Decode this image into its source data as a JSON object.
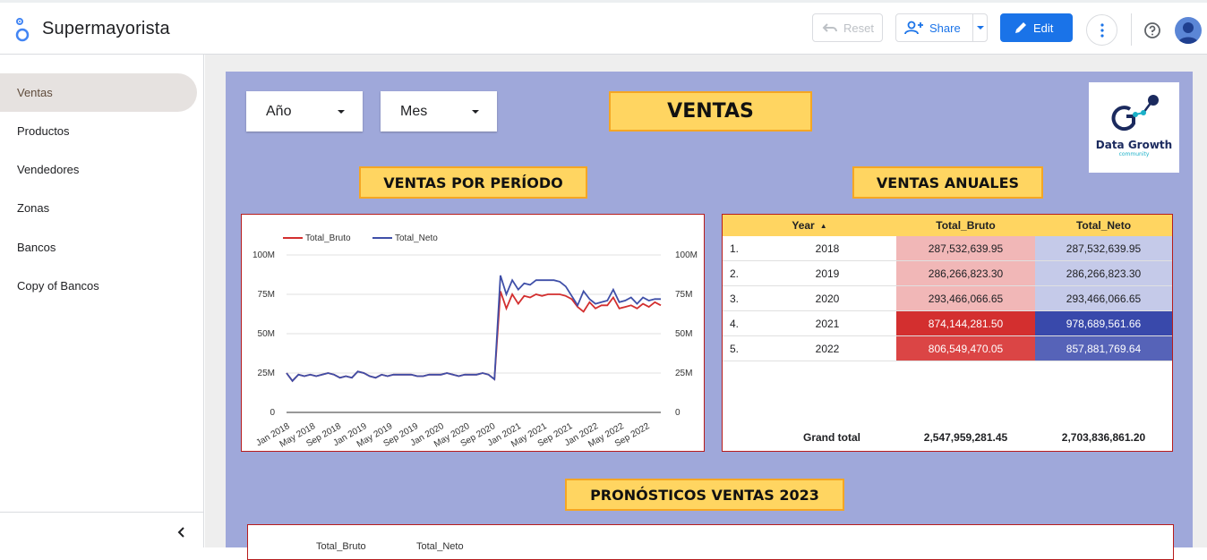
{
  "app": {
    "title": "Supermayorista"
  },
  "toolbar": {
    "reset_label": "Reset",
    "share_label": "Share",
    "edit_label": "Edit"
  },
  "sidebar": {
    "items": [
      {
        "label": "Ventas",
        "active": true
      },
      {
        "label": "Productos"
      },
      {
        "label": "Vendedores"
      },
      {
        "label": "Zonas"
      },
      {
        "label": "Bancos"
      },
      {
        "label": "Copy of Bancos"
      }
    ]
  },
  "filters": {
    "year_label": "Año",
    "month_label": "Mes"
  },
  "report": {
    "main_title": "VENTAS",
    "period_title": "VENTAS POR PERÍODO",
    "annual_title": "VENTAS ANUALES",
    "forecast_title": "PRONÓSTICOS VENTAS 2023",
    "logo_text": "Data Growth",
    "logo_subtext": "community"
  },
  "chart_data": {
    "type": "line",
    "legend": [
      "Total_Bruto",
      "Total_Neto"
    ],
    "colors": {
      "Total_Bruto": "#d32f2f",
      "Total_Neto": "#3f4fa8"
    },
    "y_ticks": [
      "100M",
      "75M",
      "50M",
      "25M",
      "0"
    ],
    "ylim": [
      0,
      100000000
    ],
    "x_tick_labels": [
      "Jan 2018",
      "May 2018",
      "Sep 2018",
      "Jan 2019",
      "May 2019",
      "Sep 2019",
      "Jan 2020",
      "May 2020",
      "Sep 2020",
      "Jan 2021",
      "May 2021",
      "Sep 2021",
      "Jan 2022",
      "May 2022",
      "Sep 2022"
    ],
    "x": [
      "Jan 2018",
      "Feb 2018",
      "Mar 2018",
      "Apr 2018",
      "May 2018",
      "Jun 2018",
      "Jul 2018",
      "Aug 2018",
      "Sep 2018",
      "Oct 2018",
      "Nov 2018",
      "Dec 2018",
      "Jan 2019",
      "Feb 2019",
      "Mar 2019",
      "Apr 2019",
      "May 2019",
      "Jun 2019",
      "Jul 2019",
      "Aug 2019",
      "Sep 2019",
      "Oct 2019",
      "Nov 2019",
      "Dec 2019",
      "Jan 2020",
      "Feb 2020",
      "Mar 2020",
      "Apr 2020",
      "May 2020",
      "Jun 2020",
      "Jul 2020",
      "Aug 2020",
      "Sep 2020",
      "Oct 2020",
      "Nov 2020",
      "Dec 2020",
      "Jan 2021",
      "Feb 2021",
      "Mar 2021",
      "Apr 2021",
      "May 2021",
      "Jun 2021",
      "Jul 2021",
      "Aug 2021",
      "Sep 2021",
      "Oct 2021",
      "Nov 2021",
      "Dec 2021",
      "Jan 2022",
      "Feb 2022",
      "Mar 2022",
      "Apr 2022",
      "May 2022",
      "Jun 2022",
      "Jul 2022",
      "Aug 2022",
      "Sep 2022",
      "Oct 2022",
      "Nov 2022",
      "Dec 2022"
    ],
    "series": [
      {
        "name": "Total_Bruto",
        "values": [
          25,
          20,
          24,
          23,
          24,
          23,
          24,
          25,
          24,
          22,
          23,
          22,
          26,
          25,
          23,
          22,
          24,
          23,
          24,
          24,
          24,
          24,
          23,
          23,
          24,
          24,
          24,
          25,
          24,
          23,
          24,
          24,
          24,
          25,
          24,
          21,
          77,
          66,
          75,
          69,
          74,
          73,
          75,
          74,
          75,
          75,
          75,
          74,
          72,
          67,
          64,
          70,
          66,
          68,
          68,
          73,
          66,
          67,
          68,
          66,
          69,
          67,
          70,
          68
        ],
        "note_series_length_matches_x": ""
      },
      {
        "name": "Total_Neto",
        "values": [
          25,
          20,
          24,
          23,
          24,
          23,
          24,
          25,
          24,
          22,
          23,
          22,
          26,
          25,
          23,
          22,
          24,
          23,
          24,
          24,
          24,
          24,
          23,
          23,
          24,
          24,
          24,
          25,
          24,
          23,
          24,
          24,
          24,
          25,
          24,
          21,
          87,
          75,
          84,
          78,
          82,
          81,
          84,
          84,
          84,
          84,
          83,
          80,
          74,
          68,
          77,
          72,
          69,
          70,
          71,
          78,
          70,
          71,
          73,
          69,
          73,
          71,
          72,
          72
        ]
      }
    ]
  },
  "table": {
    "headers": [
      "Year",
      "Total_Bruto",
      "Total_Neto"
    ],
    "sort_indicator": "▲",
    "rows": [
      {
        "num": "1.",
        "year": "2018",
        "bruto": "287,532,639.95",
        "neto": "287,532,639.95"
      },
      {
        "num": "2.",
        "year": "2019",
        "bruto": "286,266,823.30",
        "neto": "286,266,823.30"
      },
      {
        "num": "3.",
        "year": "2020",
        "bruto": "293,466,066.65",
        "neto": "293,466,066.65"
      },
      {
        "num": "4.",
        "year": "2021",
        "bruto": "874,144,281.50",
        "neto": "978,689,561.66"
      },
      {
        "num": "5.",
        "year": "2022",
        "bruto": "806,549,470.05",
        "neto": "857,881,769.64"
      }
    ],
    "grand_total_label": "Grand total",
    "grand_total_bruto": "2,547,959,281.45",
    "grand_total_neto": "2,703,836,861.20",
    "heat_colors_bruto": [
      "#f1b7b7",
      "#f1b7b7",
      "#f1b7b7",
      "#d32f2f",
      "#db4545"
    ],
    "heat_colors_neto": [
      "#c5cae9",
      "#c5cae9",
      "#c5cae9",
      "#3949ab",
      "#5663b8"
    ]
  },
  "forecast": {
    "legend": [
      "Total_Bruto",
      "Total_Neto"
    ]
  }
}
